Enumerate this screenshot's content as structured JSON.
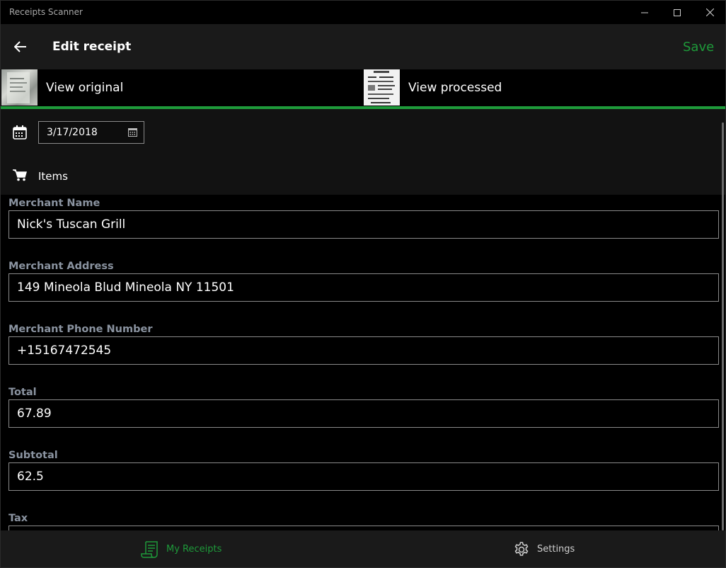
{
  "window": {
    "title": "Receipts Scanner"
  },
  "header": {
    "title": "Edit receipt",
    "save_label": "Save"
  },
  "image_tabs": [
    {
      "label": "View original"
    },
    {
      "label": "View processed"
    }
  ],
  "date": {
    "value": "3/17/2018"
  },
  "items": {
    "label": "Items"
  },
  "form": {
    "fields": [
      {
        "label": "Merchant Name",
        "value": "Nick's Tuscan Grill"
      },
      {
        "label": "Merchant Address",
        "value": "149 Mineola Blud Mineola NY 11501"
      },
      {
        "label": "Merchant Phone Number",
        "value": "+15167472545"
      },
      {
        "label": "Total",
        "value": "67.89"
      },
      {
        "label": "Subtotal",
        "value": "62.5"
      },
      {
        "label": "Tax",
        "value": ""
      }
    ]
  },
  "bottom_nav": [
    {
      "label": "My Receipts",
      "icon": "receipt-icon",
      "active": true
    },
    {
      "label": "Settings",
      "icon": "gear-icon",
      "active": false
    }
  ],
  "colors": {
    "accent": "#1e9a3a",
    "label": "#8a93a0",
    "header_bg": "#1a1a1a"
  }
}
